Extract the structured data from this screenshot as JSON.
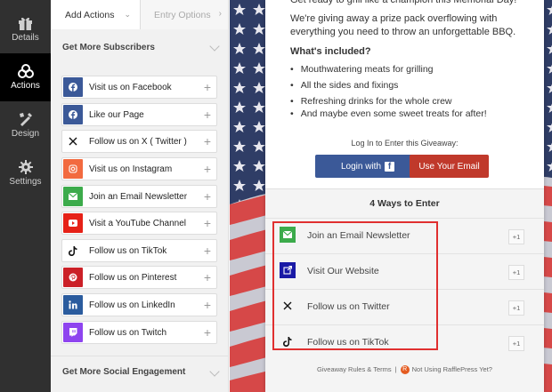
{
  "nav": {
    "items": [
      {
        "label": "Details",
        "icon": "gift-icon"
      },
      {
        "label": "Actions",
        "icon": "actions-icon"
      },
      {
        "label": "Design",
        "icon": "design-icon"
      },
      {
        "label": "Settings",
        "icon": "gear-icon"
      }
    ],
    "active_index": 1
  },
  "panel": {
    "tabs": {
      "add_actions": "Add Actions",
      "entry_options": "Entry Options"
    },
    "section1": "Get More Subscribers",
    "actions": [
      {
        "label": "Visit us on Facebook",
        "icon": "facebook-icon",
        "color": "#3b5998"
      },
      {
        "label": "Like our Page",
        "icon": "facebook-icon",
        "color": "#3b5998"
      },
      {
        "label": "Follow us on X ( Twitter )",
        "icon": "x-icon",
        "color": "#ffffff"
      },
      {
        "label": "Visit us on Instagram",
        "icon": "instagram-icon",
        "color": "#f26a3f"
      },
      {
        "label": "Join an Email Newsletter",
        "icon": "email-icon",
        "color": "#3cab4b"
      },
      {
        "label": "Visit a YouTube Channel",
        "icon": "youtube-icon",
        "color": "#e62117"
      },
      {
        "label": "Follow us on TikTok",
        "icon": "tiktok-icon",
        "color": "#ffffff"
      },
      {
        "label": "Follow us on Pinterest",
        "icon": "pinterest-icon",
        "color": "#cb2027"
      },
      {
        "label": "Follow us on LinkedIn",
        "icon": "linkedin-icon",
        "color": "#2b5c9e"
      },
      {
        "label": "Follow us on Twitch",
        "icon": "twitch-icon",
        "color": "#8e44ef"
      }
    ],
    "section2": "Get More Social Engagement"
  },
  "card": {
    "intro1": "Get ready to grill like a champion this Memorial Day!",
    "intro2a": "We're giving away a prize pack overflowing with",
    "intro2b": "everything you need to throw an unforgettable BBQ.",
    "included_heading": "What's included?",
    "bullets": [
      "Mouthwatering meats for grilling",
      "All the sides and fixings",
      "Refreshing drinks for the whole crew",
      "And maybe even some sweet treats for after!"
    ],
    "login_label": "Log In to Enter this Giveaway:",
    "login_fb": "Login with",
    "login_email": "Use Your Email",
    "ways_title": "4 Ways to Enter",
    "ways": [
      {
        "label": "Join an Email Newsletter",
        "points": "+1",
        "icon": "email-icon",
        "color": "#3cab4b"
      },
      {
        "label": "Visit Our Website",
        "points": "+1",
        "icon": "external-link-icon",
        "color": "#1a1aa6"
      },
      {
        "label": "Follow us on Twitter",
        "points": "+1",
        "icon": "x-icon",
        "color": "#f4f4f4"
      },
      {
        "label": "Follow us on TikTok",
        "points": "+1",
        "icon": "tiktok-icon",
        "color": "#f4f4f4"
      }
    ],
    "footer_rules": "Giveaway Rules & Terms",
    "footer_sep": "|",
    "footer_promo": "Not Using RafflePress Yet?"
  }
}
